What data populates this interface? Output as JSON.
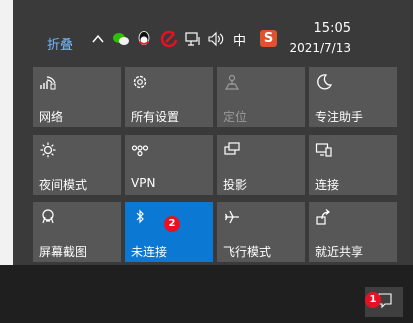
{
  "action_center": {
    "collapse_label": "折叠",
    "tiles": [
      {
        "label": "网络",
        "icon": "network-icon",
        "state": "normal"
      },
      {
        "label": "所有设置",
        "icon": "gear-icon",
        "state": "normal"
      },
      {
        "label": "定位",
        "icon": "location-icon",
        "state": "disabled"
      },
      {
        "label": "专注助手",
        "icon": "moon-icon",
        "state": "normal"
      },
      {
        "label": "夜间模式",
        "icon": "brightness-icon",
        "state": "normal"
      },
      {
        "label": "VPN",
        "icon": "vpn-icon",
        "state": "normal"
      },
      {
        "label": "投影",
        "icon": "project-icon",
        "state": "normal"
      },
      {
        "label": "连接",
        "icon": "connect-icon",
        "state": "normal"
      },
      {
        "label": "屏幕截图",
        "icon": "screenshot-icon",
        "state": "normal"
      },
      {
        "label": "未连接",
        "icon": "bluetooth-icon",
        "state": "active"
      },
      {
        "label": "飞行模式",
        "icon": "airplane-icon",
        "state": "normal"
      },
      {
        "label": "就近共享",
        "icon": "nearby-share-icon",
        "state": "normal"
      }
    ],
    "bluetooth_badge": "2",
    "accent_color": "#0b78d4"
  },
  "taskbar": {
    "ime_label": "中",
    "sogou_label": "S",
    "time": "15:05",
    "date": "2021/7/13",
    "notification_badge": "1"
  }
}
